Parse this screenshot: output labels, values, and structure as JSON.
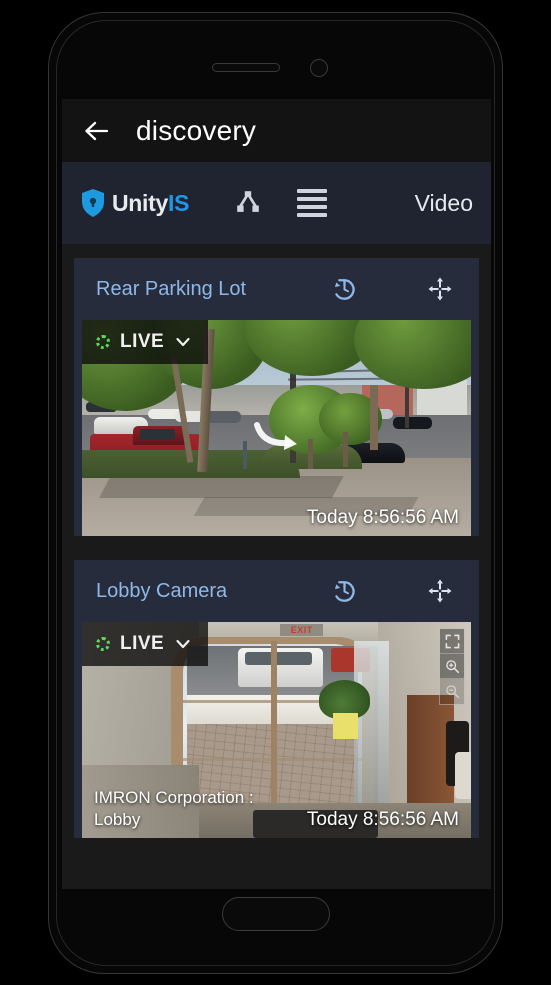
{
  "titlebar": {
    "back_icon": "back-arrow-icon",
    "title": "discovery"
  },
  "appbar": {
    "logo_icon": "shield-lock-icon",
    "brand_primary": "Unity",
    "brand_accent": "IS",
    "brand_accent_color": "#2196e8",
    "tree_icon": "tree-hierarchy-icon",
    "menu_icon": "hamburger-menu-icon",
    "section_label": "Video"
  },
  "cameras": [
    {
      "title": "Rear Parking Lot",
      "history_icon": "history-restore-icon",
      "move_icon": "move-arrows-icon",
      "live_label": "LIVE",
      "live_indicator": "recording-spinner-icon",
      "dropdown_icon": "chevron-down-icon",
      "timestamp": "Today 8:56:56 AM",
      "overlay_label": "",
      "has_controls": false,
      "scene": "outdoor-street-parking"
    },
    {
      "title": "Lobby Camera",
      "history_icon": "history-restore-icon",
      "move_icon": "move-arrows-icon",
      "live_label": "LIVE",
      "live_indicator": "recording-spinner-icon",
      "dropdown_icon": "chevron-down-icon",
      "timestamp": "Today 8:56:56 AM",
      "overlay_label": "IMRON Corporation : Lobby",
      "has_controls": true,
      "controls": [
        {
          "icon": "fullscreen-icon",
          "enabled": true
        },
        {
          "icon": "zoom-in-icon",
          "enabled": true
        },
        {
          "icon": "zoom-out-icon",
          "enabled": false
        }
      ],
      "scene": "indoor-lobby-entrance"
    }
  ],
  "colors": {
    "page_background": "#1a1a1a",
    "titlebar_background": "#131313",
    "appbar_background": "#1f2430",
    "card_background": "#262c3b",
    "card_title": "#8fb8e8",
    "accent": "#2196e8",
    "live_green": "#5ed85e"
  }
}
